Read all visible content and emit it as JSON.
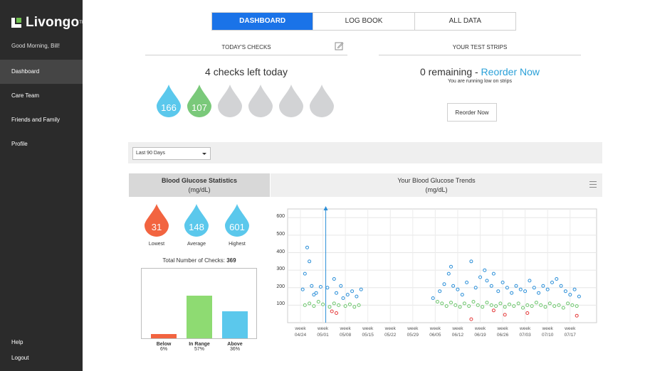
{
  "app": {
    "name": "Livongo",
    "tm": "TM"
  },
  "sidebar": {
    "greeting": "Good Morning, Bill!",
    "items": [
      {
        "label": "Dashboard",
        "active": true
      },
      {
        "label": "Care Team",
        "active": false
      },
      {
        "label": "Friends and Family",
        "active": false
      },
      {
        "label": "Profile",
        "active": false
      }
    ],
    "help": "Help",
    "logout": "Logout"
  },
  "tabs": [
    {
      "label": "DASHBOARD",
      "active": true
    },
    {
      "label": "LOG BOOK",
      "active": false
    },
    {
      "label": "ALL DATA",
      "active": false
    }
  ],
  "todays_checks": {
    "title": "TODAY'S CHECKS",
    "summary": "4 checks left today",
    "checks": [
      {
        "value": "166",
        "color": "#5bc8ec"
      },
      {
        "value": "107",
        "color": "#7ac97a"
      },
      {
        "value": "",
        "color": "#d2d3d5"
      },
      {
        "value": "",
        "color": "#d2d3d5"
      },
      {
        "value": "",
        "color": "#d2d3d5"
      },
      {
        "value": "",
        "color": "#d2d3d5"
      }
    ]
  },
  "test_strips": {
    "title": "YOUR TEST STRIPS",
    "remaining": "0 remaining - ",
    "reorder_link": "Reorder Now",
    "note": "You are running low on strips",
    "button": "Reorder Now"
  },
  "filter": {
    "range": "Last 90 Days"
  },
  "stats": {
    "title": "Blood Glucose Statistics",
    "unit": "(mg/dL)",
    "lowest": {
      "value": "31",
      "label": "Lowest",
      "color": "#f26440"
    },
    "average": {
      "value": "148",
      "label": "Average",
      "color": "#5bc8ec"
    },
    "highest": {
      "value": "601",
      "label": "Highest",
      "color": "#5bc8ec"
    },
    "total_label": "Total Number of Checks: ",
    "total_value": "369",
    "breakdown": [
      {
        "label": "Below",
        "pct": "6%",
        "value": 6,
        "color": "#f26440"
      },
      {
        "label": "In Range",
        "pct": "57%",
        "value": 57,
        "color": "#8edb72"
      },
      {
        "label": "Above",
        "pct": "36%",
        "value": 36,
        "color": "#5bc8ec"
      }
    ]
  },
  "trends": {
    "title": "Your Blood Glucose Trends",
    "unit": "(mg/dL)"
  },
  "chart_data": {
    "type": "scatter",
    "title": "Your Blood Glucose Trends",
    "ylabel": "(mg/dL)",
    "ylim": [
      0,
      650
    ],
    "yticks": [
      100,
      200,
      300,
      400,
      500,
      600
    ],
    "x_tick_prefix": "week",
    "x_ticks": [
      "04/24",
      "05/01",
      "05/08",
      "05/15",
      "05/22",
      "05/29",
      "06/05",
      "06/12",
      "06/19",
      "06/26",
      "07/03",
      "07/10",
      "07/17"
    ],
    "marker_week": "05/01",
    "series": [
      {
        "color": "#2b8fd8",
        "points": [
          [
            0.1,
            190
          ],
          [
            0.3,
            430
          ],
          [
            0.4,
            350
          ],
          [
            0.5,
            210
          ],
          [
            0.7,
            170
          ],
          [
            0.9,
            205
          ],
          [
            0.2,
            280
          ],
          [
            0.6,
            160
          ],
          [
            1.2,
            200
          ],
          [
            1.5,
            250
          ],
          [
            1.6,
            170
          ],
          [
            1.8,
            210
          ],
          [
            1.9,
            140
          ],
          [
            2.1,
            160
          ],
          [
            2.3,
            180
          ],
          [
            2.5,
            150
          ],
          [
            2.7,
            190
          ],
          [
            5.9,
            140
          ],
          [
            6.2,
            180
          ],
          [
            6.4,
            220
          ],
          [
            6.6,
            280
          ],
          [
            6.7,
            320
          ],
          [
            6.8,
            210
          ],
          [
            7.0,
            190
          ],
          [
            7.2,
            160
          ],
          [
            7.4,
            230
          ],
          [
            7.6,
            350
          ],
          [
            7.8,
            200
          ],
          [
            8.0,
            260
          ],
          [
            8.2,
            300
          ],
          [
            8.3,
            240
          ],
          [
            8.5,
            210
          ],
          [
            8.6,
            280
          ],
          [
            8.8,
            180
          ],
          [
            9.0,
            230
          ],
          [
            9.2,
            200
          ],
          [
            9.4,
            170
          ],
          [
            9.6,
            210
          ],
          [
            9.8,
            190
          ],
          [
            10.0,
            180
          ],
          [
            10.2,
            240
          ],
          [
            10.4,
            200
          ],
          [
            10.6,
            170
          ],
          [
            10.8,
            210
          ],
          [
            11.0,
            190
          ],
          [
            11.2,
            230
          ],
          [
            11.4,
            250
          ],
          [
            11.6,
            210
          ],
          [
            11.8,
            180
          ],
          [
            12.0,
            160
          ],
          [
            12.2,
            190
          ],
          [
            12.4,
            150
          ]
        ]
      },
      {
        "color": "#6cc56c",
        "points": [
          [
            0.2,
            100
          ],
          [
            0.4,
            110
          ],
          [
            0.6,
            95
          ],
          [
            0.8,
            120
          ],
          [
            1.0,
            105
          ],
          [
            1.3,
            90
          ],
          [
            1.5,
            110
          ],
          [
            1.7,
            100
          ],
          [
            2.0,
            95
          ],
          [
            2.2,
            105
          ],
          [
            2.4,
            90
          ],
          [
            2.6,
            100
          ],
          [
            6.1,
            120
          ],
          [
            6.3,
            110
          ],
          [
            6.5,
            95
          ],
          [
            6.7,
            115
          ],
          [
            6.9,
            100
          ],
          [
            7.1,
            90
          ],
          [
            7.3,
            110
          ],
          [
            7.5,
            95
          ],
          [
            7.7,
            120
          ],
          [
            7.9,
            100
          ],
          [
            8.1,
            90
          ],
          [
            8.3,
            115
          ],
          [
            8.5,
            100
          ],
          [
            8.7,
            95
          ],
          [
            8.9,
            110
          ],
          [
            9.1,
            90
          ],
          [
            9.3,
            105
          ],
          [
            9.5,
            95
          ],
          [
            9.7,
            110
          ],
          [
            9.9,
            85
          ],
          [
            10.1,
            100
          ],
          [
            10.3,
            95
          ],
          [
            10.5,
            115
          ],
          [
            10.7,
            100
          ],
          [
            10.9,
            90
          ],
          [
            11.1,
            110
          ],
          [
            11.3,
            95
          ],
          [
            11.5,
            100
          ],
          [
            11.7,
            85
          ],
          [
            11.9,
            110
          ],
          [
            12.1,
            100
          ],
          [
            12.3,
            95
          ]
        ]
      },
      {
        "color": "#e53b3b",
        "points": [
          [
            1.4,
            65
          ],
          [
            1.6,
            55
          ],
          [
            7.6,
            20
          ],
          [
            9.1,
            45
          ],
          [
            10.1,
            55
          ],
          [
            12.3,
            40
          ],
          [
            8.6,
            70
          ]
        ]
      }
    ]
  }
}
